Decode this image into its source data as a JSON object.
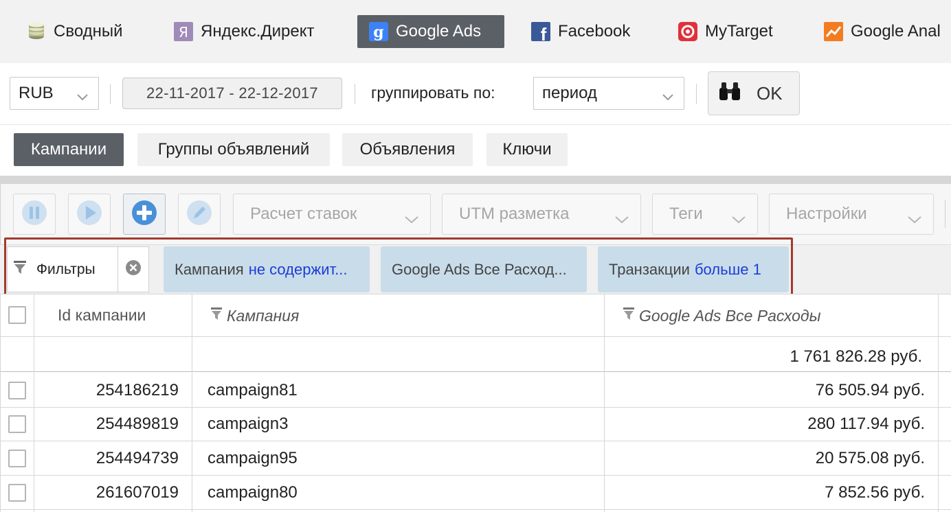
{
  "sources": {
    "tabs": [
      {
        "label": "Сводный",
        "icon": "database-stack-icon"
      },
      {
        "label": "Яндекс.Директ",
        "icon": "yandex-logo-icon"
      },
      {
        "label": "Google Ads",
        "icon": "google-logo-icon",
        "active": true
      },
      {
        "label": "Facebook",
        "icon": "facebook-logo-icon"
      },
      {
        "label": "MyTarget",
        "icon": "mytarget-logo-icon"
      },
      {
        "label": "Google Anal",
        "icon": "google-analytics-logo-icon"
      }
    ]
  },
  "filters": {
    "currency": "RUB",
    "date_range": "22-11-2017 - 22-12-2017",
    "group_label": "группировать по:",
    "group_value": "период",
    "ok_label": "OK"
  },
  "levels": {
    "tabs": [
      {
        "label": "Кампании",
        "active": true
      },
      {
        "label": "Группы объявлений"
      },
      {
        "label": "Объявления"
      },
      {
        "label": "Ключи"
      }
    ]
  },
  "toolbar": {
    "icons": [
      "pause-icon",
      "play-icon",
      "plus-icon",
      "pencil-icon"
    ],
    "dropdowns": [
      "Расчет ставок",
      "UTM разметка",
      "Теги",
      "Настройки"
    ]
  },
  "chips": {
    "filters_label": "Фильтры",
    "items": [
      {
        "field": "Кампания",
        "op": "не содержит..."
      },
      {
        "field": "Google Ads Все Расход...",
        "op": ""
      },
      {
        "field": "Транзакции",
        "op": "больше 1"
      }
    ]
  },
  "table": {
    "headers": {
      "id": "Id кампании",
      "campaign": "Кампания",
      "cost": "Google Ads Все Расходы"
    },
    "total_cost": "1 761 826.28 руб.",
    "rows": [
      {
        "id": "254186219",
        "campaign": "campaign81",
        "cost": "76 505.94 руб."
      },
      {
        "id": "254489819",
        "campaign": "campaign3",
        "cost": "280 117.94 руб."
      },
      {
        "id": "254494739",
        "campaign": "campaign95",
        "cost": "20 575.08 руб."
      },
      {
        "id": "261607019",
        "campaign": "campaign80",
        "cost": "7 852.56 руб."
      }
    ]
  },
  "colors": {
    "active_tab": "#5b5f66",
    "chip_bg": "#c9dcea",
    "chip_operator": "#1a3ed6",
    "highlight_frame": "#a33a2e",
    "toolbar_icon": "#7ab7ea"
  }
}
